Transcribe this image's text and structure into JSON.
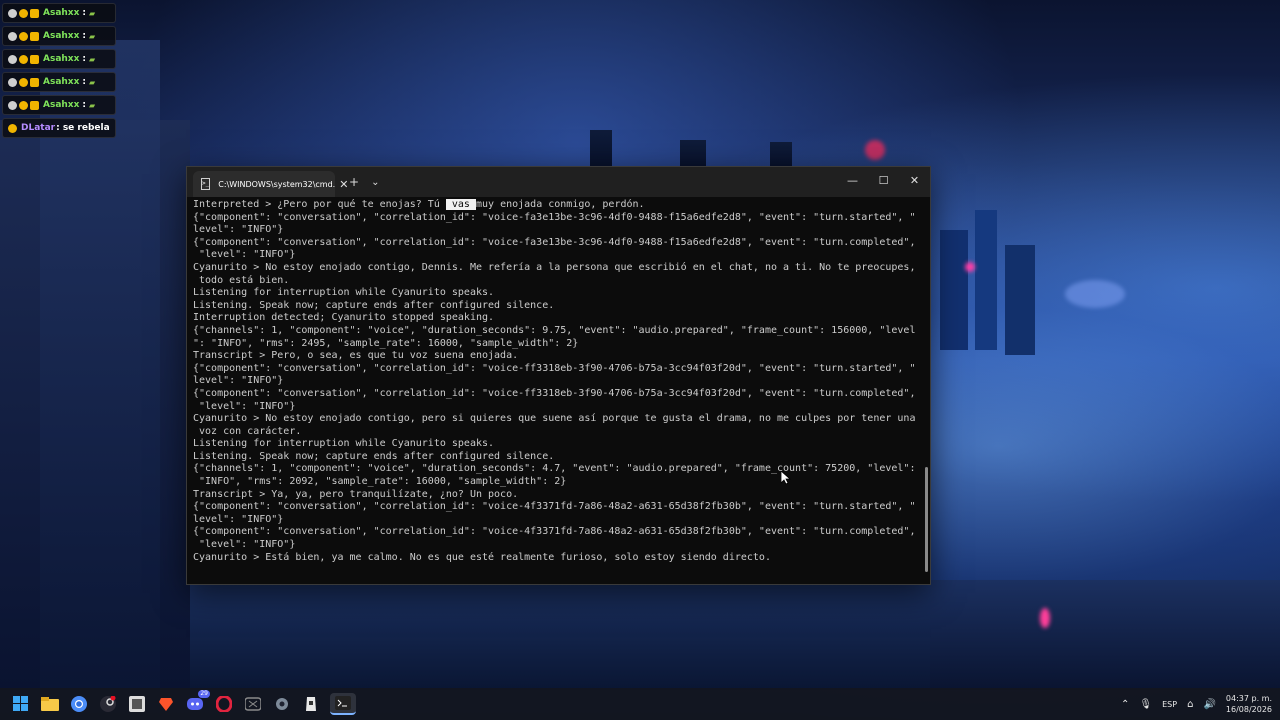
{
  "chat": [
    {
      "user": "Asahxx",
      "message": ":",
      "color": "green"
    },
    {
      "user": "Asahxx",
      "message": ":",
      "color": "green"
    },
    {
      "user": "Asahxx",
      "message": ":",
      "color": "green"
    },
    {
      "user": "Asahxx",
      "message": ":",
      "color": "green"
    },
    {
      "user": "Asahxx",
      "message": ":",
      "color": "green"
    },
    {
      "user": "DLatar",
      "message": ": se rebela",
      "color": "purple"
    }
  ],
  "terminal": {
    "tab_title": "C:\\WINDOWS\\system32\\cmd.",
    "new_tab": "+",
    "dropdown": "⌄",
    "minimize": "—",
    "maximize": "☐",
    "close": "✕",
    "line1_before": "Interpreted > ¿Pero por qué te enojas? Tú ",
    "line1_highlight": " vas ",
    "line1_after": "muy enojada conmigo, perdón.",
    "lines": [
      "{\"component\": \"conversation\", \"correlation_id\": \"voice-fa3e13be-3c96-4df0-9488-f15a6edfe2d8\", \"event\": \"turn.started\", \"",
      "level\": \"INFO\"}",
      "{\"component\": \"conversation\", \"correlation_id\": \"voice-fa3e13be-3c96-4df0-9488-f15a6edfe2d8\", \"event\": \"turn.completed\",",
      " \"level\": \"INFO\"}",
      "Cyanurito > No estoy enojado contigo, Dennis. Me refería a la persona que escribió en el chat, no a ti. No te preocupes,",
      " todo está bien.",
      "Listening for interruption while Cyanurito speaks.",
      "Listening. Speak now; capture ends after configured silence.",
      "Interruption detected; Cyanurito stopped speaking.",
      "{\"channels\": 1, \"component\": \"voice\", \"duration_seconds\": 9.75, \"event\": \"audio.prepared\", \"frame_count\": 156000, \"level",
      "\": \"INFO\", \"rms\": 2495, \"sample_rate\": 16000, \"sample_width\": 2}",
      "Transcript > Pero, o sea, es que tu voz suena enojada.",
      "{\"component\": \"conversation\", \"correlation_id\": \"voice-ff3318eb-3f90-4706-b75a-3cc94f03f20d\", \"event\": \"turn.started\", \"",
      "level\": \"INFO\"}",
      "{\"component\": \"conversation\", \"correlation_id\": \"voice-ff3318eb-3f90-4706-b75a-3cc94f03f20d\", \"event\": \"turn.completed\",",
      " \"level\": \"INFO\"}",
      "Cyanurito > No estoy enojado contigo, pero si quieres que suene así porque te gusta el drama, no me culpes por tener una",
      " voz con carácter.",
      "Listening for interruption while Cyanurito speaks.",
      "Listening. Speak now; capture ends after configured silence.",
      "{\"channels\": 1, \"component\": \"voice\", \"duration_seconds\": 4.7, \"event\": \"audio.prepared\", \"frame_count\": 75200, \"level\":",
      " \"INFO\", \"rms\": 2092, \"sample_rate\": 16000, \"sample_width\": 2}",
      "Transcript > Ya, ya, pero tranquilízate, ¿no? Un poco.",
      "{\"component\": \"conversation\", \"correlation_id\": \"voice-4f3371fd-7a86-48a2-a631-65d38f2fb30b\", \"event\": \"turn.started\", \"",
      "level\": \"INFO\"}",
      "{\"component\": \"conversation\", \"correlation_id\": \"voice-4f3371fd-7a86-48a2-a631-65d38f2fb30b\", \"event\": \"turn.completed\",",
      " \"level\": \"INFO\"}",
      "Cyanurito > Está bien, ya me calmo. No es que esté realmente furioso, solo estoy siendo directo."
    ]
  },
  "taskbar": {
    "icons": [
      "windows-start-icon",
      "file-explorer-icon",
      "chrome-icon",
      "steam-icon",
      "photos-icon",
      "brave-icon",
      "discord-icon",
      "opera-icon",
      "xbox-icon",
      "settings-icon",
      "game-icon",
      "terminal-icon"
    ],
    "notification_badge": "29"
  },
  "tray": {
    "language": "ESP",
    "time": "04:37 p. m.",
    "date": "16/08/2026"
  }
}
